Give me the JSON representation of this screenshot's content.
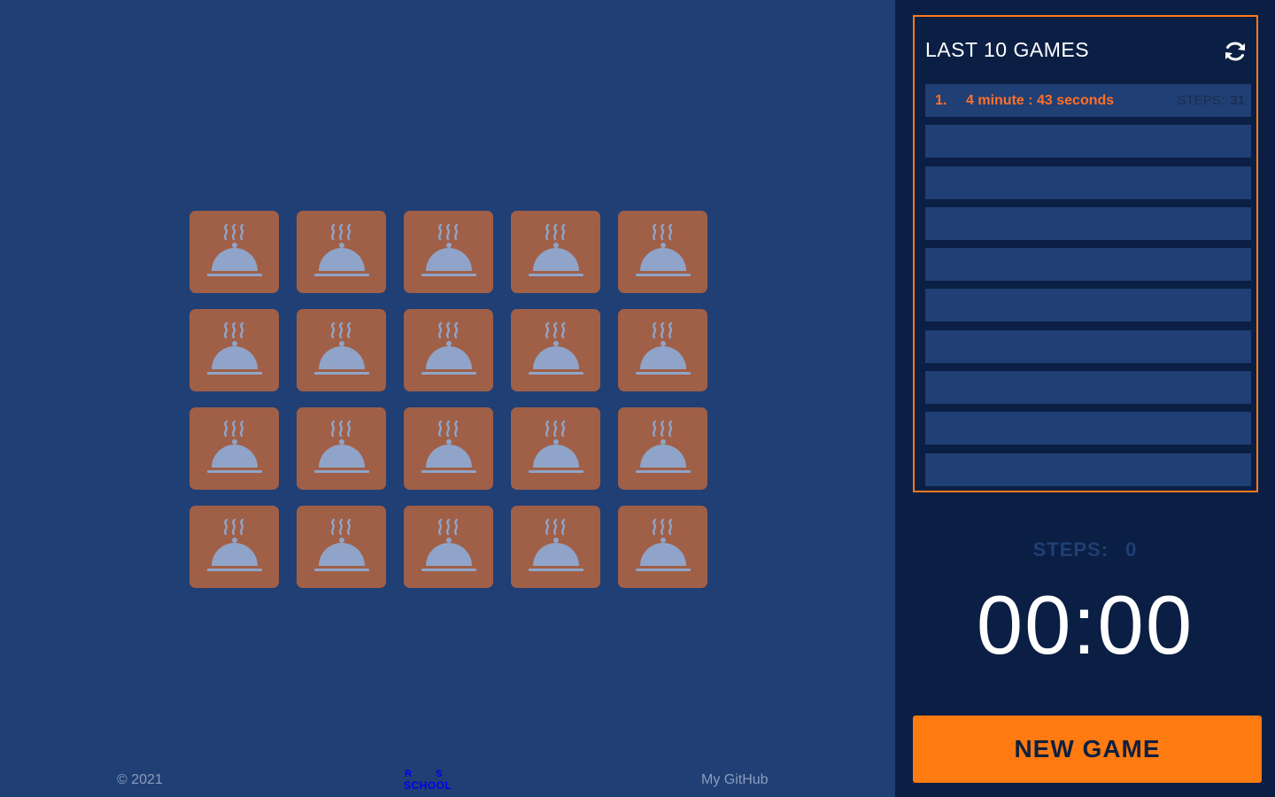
{
  "board": {
    "rows": 4,
    "columns": 5,
    "card_icon": "cloche-icon"
  },
  "footer": {
    "copyright": "© 2021",
    "logo_r": "R",
    "logo_s": "S",
    "logo_school": "SCHOOL",
    "github_label": "My GitHub"
  },
  "sidebar": {
    "title": "LAST 10 GAMES",
    "refresh_icon": "refresh-icon",
    "games": [
      {
        "num": "1.",
        "time": "4 minute : 43 seconds",
        "steps_label": "STEPS:",
        "steps": "31"
      },
      {
        "num": "",
        "time": "",
        "steps_label": "",
        "steps": ""
      },
      {
        "num": "",
        "time": "",
        "steps_label": "",
        "steps": ""
      },
      {
        "num": "",
        "time": "",
        "steps_label": "",
        "steps": ""
      },
      {
        "num": "",
        "time": "",
        "steps_label": "",
        "steps": ""
      },
      {
        "num": "",
        "time": "",
        "steps_label": "",
        "steps": ""
      },
      {
        "num": "",
        "time": "",
        "steps_label": "",
        "steps": ""
      },
      {
        "num": "",
        "time": "",
        "steps_label": "",
        "steps": ""
      },
      {
        "num": "",
        "time": "",
        "steps_label": "",
        "steps": ""
      },
      {
        "num": "",
        "time": "",
        "steps_label": "",
        "steps": ""
      }
    ],
    "steps_label": "STEPS:",
    "steps_value": "0",
    "timer": "00:00",
    "new_game_label": "NEW GAME"
  },
  "colors": {
    "background": "#203f74",
    "sidebar": "#0b1f44",
    "card": "#a05f47",
    "accent": "#ff7a10"
  }
}
